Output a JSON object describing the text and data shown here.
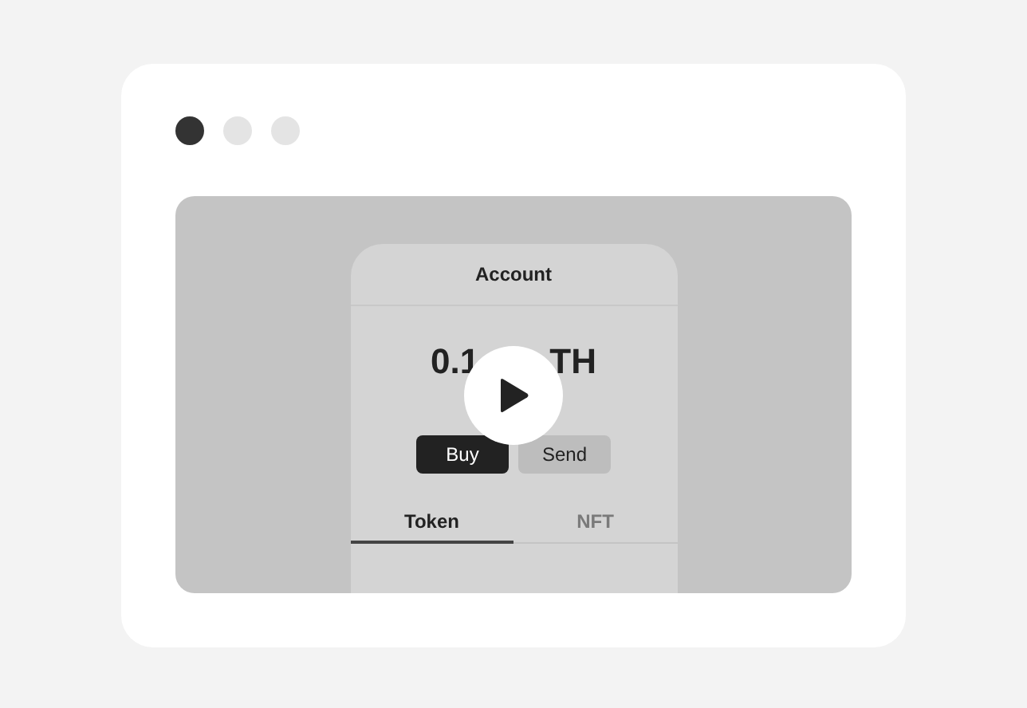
{
  "window": {
    "dots": [
      {
        "color": "#333333"
      },
      {
        "color": "#e4e4e4"
      },
      {
        "color": "#e4e4e4"
      }
    ]
  },
  "video": {
    "app": {
      "title": "Account",
      "balance_parts": [
        "0.1",
        "TH"
      ],
      "buttons": [
        {
          "label": "Buy",
          "kind": "primary"
        },
        {
          "label": "Send",
          "kind": "secondary"
        }
      ],
      "tabs": [
        {
          "label": "Token",
          "selected": true
        },
        {
          "label": "NFT",
          "selected": false
        }
      ]
    }
  }
}
